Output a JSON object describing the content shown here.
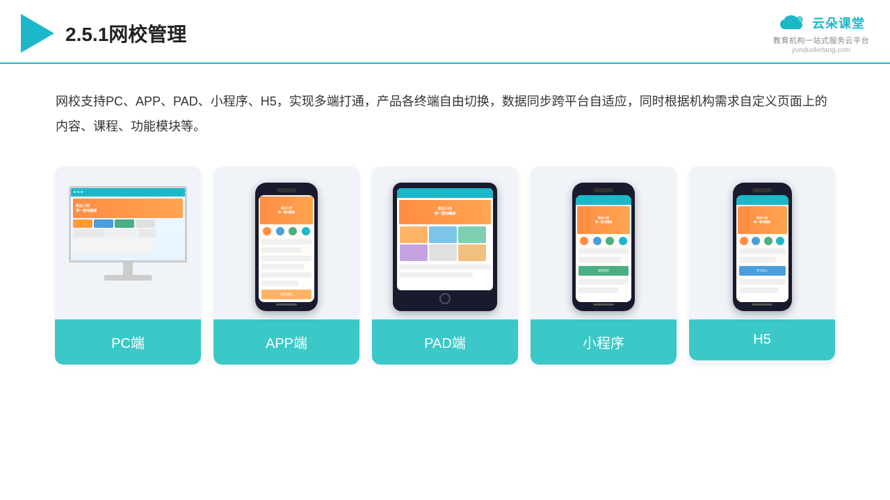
{
  "header": {
    "title": "2.5.1网校管理",
    "logo_name": "云朵课堂",
    "logo_url": "yunduoketang.com",
    "logo_tagline": "教育机构一站式服务云平台"
  },
  "description": {
    "text": "网校支持PC、APP、PAD、小程序、H5，实现多端打通，产品各终端自由切换，数据同步跨平台自适应，同时根据机构需求自定义页面上的内容、课程、功能模块等。"
  },
  "cards": [
    {
      "id": "pc",
      "label": "PC端"
    },
    {
      "id": "app",
      "label": "APP端"
    },
    {
      "id": "pad",
      "label": "PAD端"
    },
    {
      "id": "miniapp",
      "label": "小程序"
    },
    {
      "id": "h5",
      "label": "H5"
    }
  ],
  "accent_color": "#3bc8c8",
  "dark_color": "#1cb8c8"
}
